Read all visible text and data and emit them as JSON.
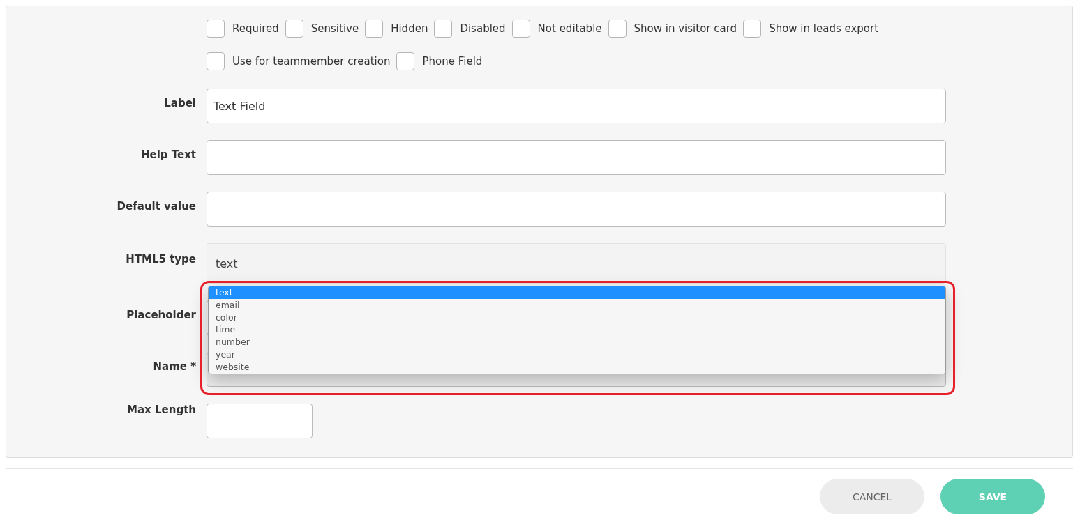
{
  "checkboxes": [
    {
      "label": "Required",
      "checked": false
    },
    {
      "label": "Sensitive",
      "checked": false
    },
    {
      "label": "Hidden",
      "checked": false
    },
    {
      "label": "Disabled",
      "checked": false
    },
    {
      "label": "Not editable",
      "checked": false
    },
    {
      "label": "Show in visitor card",
      "checked": false
    },
    {
      "label": "Show in leads export",
      "checked": false
    },
    {
      "label": "Use for teammember creation",
      "checked": false
    },
    {
      "label": "Phone Field",
      "checked": false
    }
  ],
  "fields": [
    {
      "label": "Label",
      "kind": "input",
      "value": "Text Field"
    },
    {
      "label": "Help Text",
      "kind": "input"
    },
    {
      "label": "Default value",
      "kind": "input"
    },
    {
      "label": "HTML5 type",
      "kind": "select",
      "value": "text",
      "expanded": true,
      "highlighted": true,
      "options": [
        {
          "label": "text",
          "selected": true
        },
        {
          "label": "email",
          "selected": false
        },
        {
          "label": "color",
          "selected": false
        },
        {
          "label": "time",
          "selected": false
        },
        {
          "label": "number",
          "selected": false
        },
        {
          "label": "year",
          "selected": false
        },
        {
          "label": "website",
          "selected": false
        }
      ]
    },
    {
      "label": "Placeholder",
      "kind": "input"
    },
    {
      "label": "Name *",
      "kind": "readonly"
    },
    {
      "label": "Max Length",
      "kind": "short"
    }
  ],
  "buttons": [
    {
      "label": "CANCEL",
      "kind": "secondary"
    },
    {
      "label": "SAVE",
      "kind": "primary"
    }
  ]
}
